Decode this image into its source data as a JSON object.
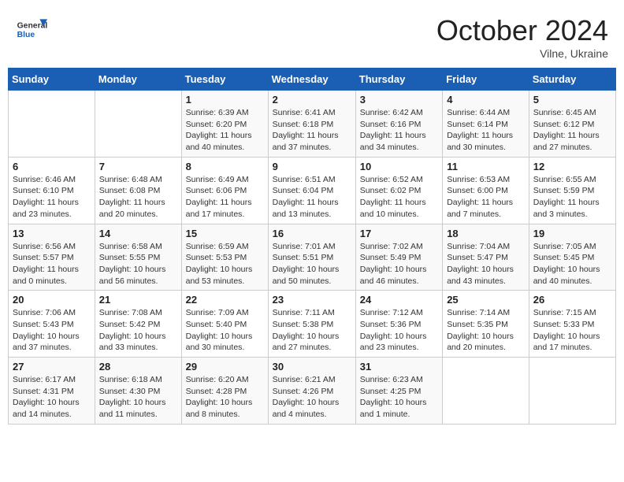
{
  "header": {
    "logo_general": "General",
    "logo_blue": "Blue",
    "month_title": "October 2024",
    "location": "Vilne, Ukraine"
  },
  "days_of_week": [
    "Sunday",
    "Monday",
    "Tuesday",
    "Wednesday",
    "Thursday",
    "Friday",
    "Saturday"
  ],
  "weeks": [
    [
      {
        "day": "",
        "detail": ""
      },
      {
        "day": "",
        "detail": ""
      },
      {
        "day": "1",
        "detail": "Sunrise: 6:39 AM\nSunset: 6:20 PM\nDaylight: 11 hours and 40 minutes."
      },
      {
        "day": "2",
        "detail": "Sunrise: 6:41 AM\nSunset: 6:18 PM\nDaylight: 11 hours and 37 minutes."
      },
      {
        "day": "3",
        "detail": "Sunrise: 6:42 AM\nSunset: 6:16 PM\nDaylight: 11 hours and 34 minutes."
      },
      {
        "day": "4",
        "detail": "Sunrise: 6:44 AM\nSunset: 6:14 PM\nDaylight: 11 hours and 30 minutes."
      },
      {
        "day": "5",
        "detail": "Sunrise: 6:45 AM\nSunset: 6:12 PM\nDaylight: 11 hours and 27 minutes."
      }
    ],
    [
      {
        "day": "6",
        "detail": "Sunrise: 6:46 AM\nSunset: 6:10 PM\nDaylight: 11 hours and 23 minutes."
      },
      {
        "day": "7",
        "detail": "Sunrise: 6:48 AM\nSunset: 6:08 PM\nDaylight: 11 hours and 20 minutes."
      },
      {
        "day": "8",
        "detail": "Sunrise: 6:49 AM\nSunset: 6:06 PM\nDaylight: 11 hours and 17 minutes."
      },
      {
        "day": "9",
        "detail": "Sunrise: 6:51 AM\nSunset: 6:04 PM\nDaylight: 11 hours and 13 minutes."
      },
      {
        "day": "10",
        "detail": "Sunrise: 6:52 AM\nSunset: 6:02 PM\nDaylight: 11 hours and 10 minutes."
      },
      {
        "day": "11",
        "detail": "Sunrise: 6:53 AM\nSunset: 6:00 PM\nDaylight: 11 hours and 7 minutes."
      },
      {
        "day": "12",
        "detail": "Sunrise: 6:55 AM\nSunset: 5:59 PM\nDaylight: 11 hours and 3 minutes."
      }
    ],
    [
      {
        "day": "13",
        "detail": "Sunrise: 6:56 AM\nSunset: 5:57 PM\nDaylight: 11 hours and 0 minutes."
      },
      {
        "day": "14",
        "detail": "Sunrise: 6:58 AM\nSunset: 5:55 PM\nDaylight: 10 hours and 56 minutes."
      },
      {
        "day": "15",
        "detail": "Sunrise: 6:59 AM\nSunset: 5:53 PM\nDaylight: 10 hours and 53 minutes."
      },
      {
        "day": "16",
        "detail": "Sunrise: 7:01 AM\nSunset: 5:51 PM\nDaylight: 10 hours and 50 minutes."
      },
      {
        "day": "17",
        "detail": "Sunrise: 7:02 AM\nSunset: 5:49 PM\nDaylight: 10 hours and 46 minutes."
      },
      {
        "day": "18",
        "detail": "Sunrise: 7:04 AM\nSunset: 5:47 PM\nDaylight: 10 hours and 43 minutes."
      },
      {
        "day": "19",
        "detail": "Sunrise: 7:05 AM\nSunset: 5:45 PM\nDaylight: 10 hours and 40 minutes."
      }
    ],
    [
      {
        "day": "20",
        "detail": "Sunrise: 7:06 AM\nSunset: 5:43 PM\nDaylight: 10 hours and 37 minutes."
      },
      {
        "day": "21",
        "detail": "Sunrise: 7:08 AM\nSunset: 5:42 PM\nDaylight: 10 hours and 33 minutes."
      },
      {
        "day": "22",
        "detail": "Sunrise: 7:09 AM\nSunset: 5:40 PM\nDaylight: 10 hours and 30 minutes."
      },
      {
        "day": "23",
        "detail": "Sunrise: 7:11 AM\nSunset: 5:38 PM\nDaylight: 10 hours and 27 minutes."
      },
      {
        "day": "24",
        "detail": "Sunrise: 7:12 AM\nSunset: 5:36 PM\nDaylight: 10 hours and 23 minutes."
      },
      {
        "day": "25",
        "detail": "Sunrise: 7:14 AM\nSunset: 5:35 PM\nDaylight: 10 hours and 20 minutes."
      },
      {
        "day": "26",
        "detail": "Sunrise: 7:15 AM\nSunset: 5:33 PM\nDaylight: 10 hours and 17 minutes."
      }
    ],
    [
      {
        "day": "27",
        "detail": "Sunrise: 6:17 AM\nSunset: 4:31 PM\nDaylight: 10 hours and 14 minutes."
      },
      {
        "day": "28",
        "detail": "Sunrise: 6:18 AM\nSunset: 4:30 PM\nDaylight: 10 hours and 11 minutes."
      },
      {
        "day": "29",
        "detail": "Sunrise: 6:20 AM\nSunset: 4:28 PM\nDaylight: 10 hours and 8 minutes."
      },
      {
        "day": "30",
        "detail": "Sunrise: 6:21 AM\nSunset: 4:26 PM\nDaylight: 10 hours and 4 minutes."
      },
      {
        "day": "31",
        "detail": "Sunrise: 6:23 AM\nSunset: 4:25 PM\nDaylight: 10 hours and 1 minute."
      },
      {
        "day": "",
        "detail": ""
      },
      {
        "day": "",
        "detail": ""
      }
    ]
  ]
}
